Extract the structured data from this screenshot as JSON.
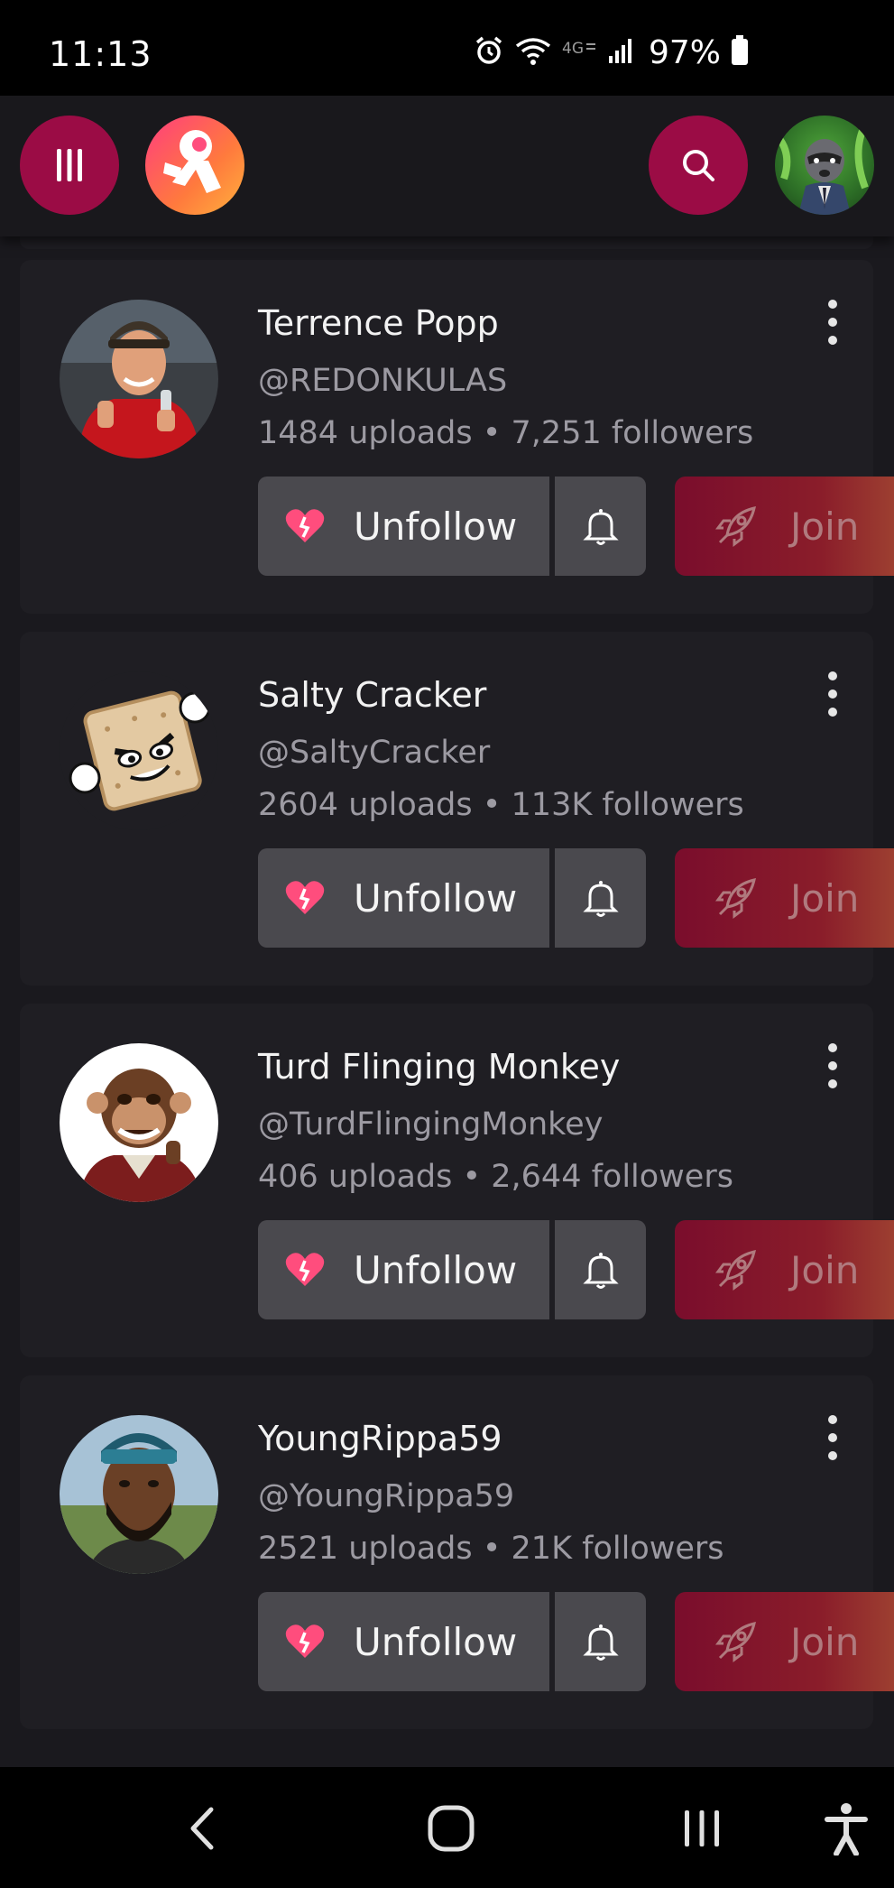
{
  "status_bar": {
    "time": "11:13",
    "battery": "97%",
    "icons": [
      "alarm-icon",
      "wifi-icon",
      "4g-icon",
      "signal-icon",
      "battery-icon"
    ]
  },
  "header": {
    "menu_icon": "menu-bars-icon",
    "logo_icon": "app-logo-icon",
    "search_icon": "search-icon",
    "avatar_icon": "user-avatar"
  },
  "buttons": {
    "unfollow_label": "Unfollow",
    "join_label": "Join"
  },
  "creators": [
    {
      "name": "Terrence Popp",
      "handle": "@REDONKULAS",
      "stats": "1484 uploads • 7,251 followers"
    },
    {
      "name": "Salty Cracker",
      "handle": "@SaltyCracker",
      "stats": "2604 uploads • 113K followers"
    },
    {
      "name": "Turd Flinging Monkey",
      "handle": "@TurdFlingingMonkey",
      "stats": "406 uploads • 2,644 followers"
    },
    {
      "name": "YoungRippa59",
      "handle": "@YoungRippa59",
      "stats": "2521 uploads • 21K followers"
    }
  ],
  "colors": {
    "accent": "#9b0c45",
    "card": "#1f1e23",
    "button": "#4a494e",
    "background": "#1a191e"
  },
  "nav": [
    "back-icon",
    "home-icon",
    "recents-icon",
    "accessibility-icon"
  ]
}
